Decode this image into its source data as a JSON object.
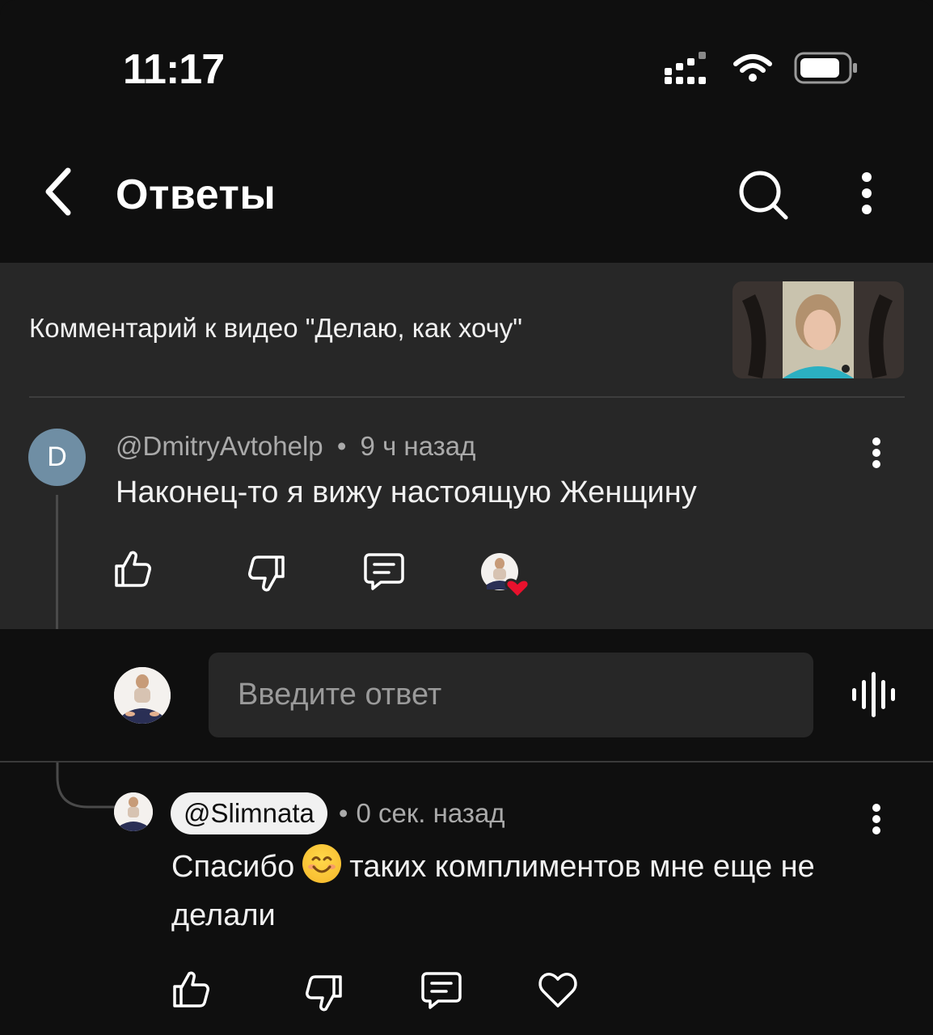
{
  "status_bar": {
    "time": "11:17",
    "icons": [
      "cellular-signal-icon",
      "wifi-icon",
      "battery-icon"
    ]
  },
  "header": {
    "title": "Ответы",
    "back_icon": "chevron-left-icon",
    "search_icon": "search-icon",
    "more_icon": "more-vertical-icon"
  },
  "original_comment": {
    "context": "Комментарий к видео \"Делаю, как хочу\"",
    "avatar_letter": "D",
    "author": "@DmitryAvtohelp",
    "separator": "•",
    "time": "9 ч назад",
    "text": "Наконец-то я вижу настоящую Женщину",
    "actions": [
      "like-icon",
      "dislike-icon",
      "reply-icon",
      "creator-heart-badge"
    ]
  },
  "reply_input": {
    "placeholder": "Введите ответ",
    "voice_icon": "voice-search-icon"
  },
  "reply": {
    "author": "@Slimnata",
    "separator": "•",
    "time": "0 сек. назад",
    "text_before_emoji": "Спасибо",
    "emoji": "smiling-face-emoji",
    "text_after_emoji": "таких комплиментов мне еще не делали",
    "actions": [
      "like-icon",
      "dislike-icon",
      "reply-icon",
      "heart-icon"
    ]
  },
  "colors": {
    "background": "#0f0f0f",
    "panel": "#272727",
    "text_primary": "#f1f1f1",
    "text_secondary": "#aaaaaa",
    "avatar_d": "#6f8ea4",
    "heart_red": "#e8112d"
  }
}
